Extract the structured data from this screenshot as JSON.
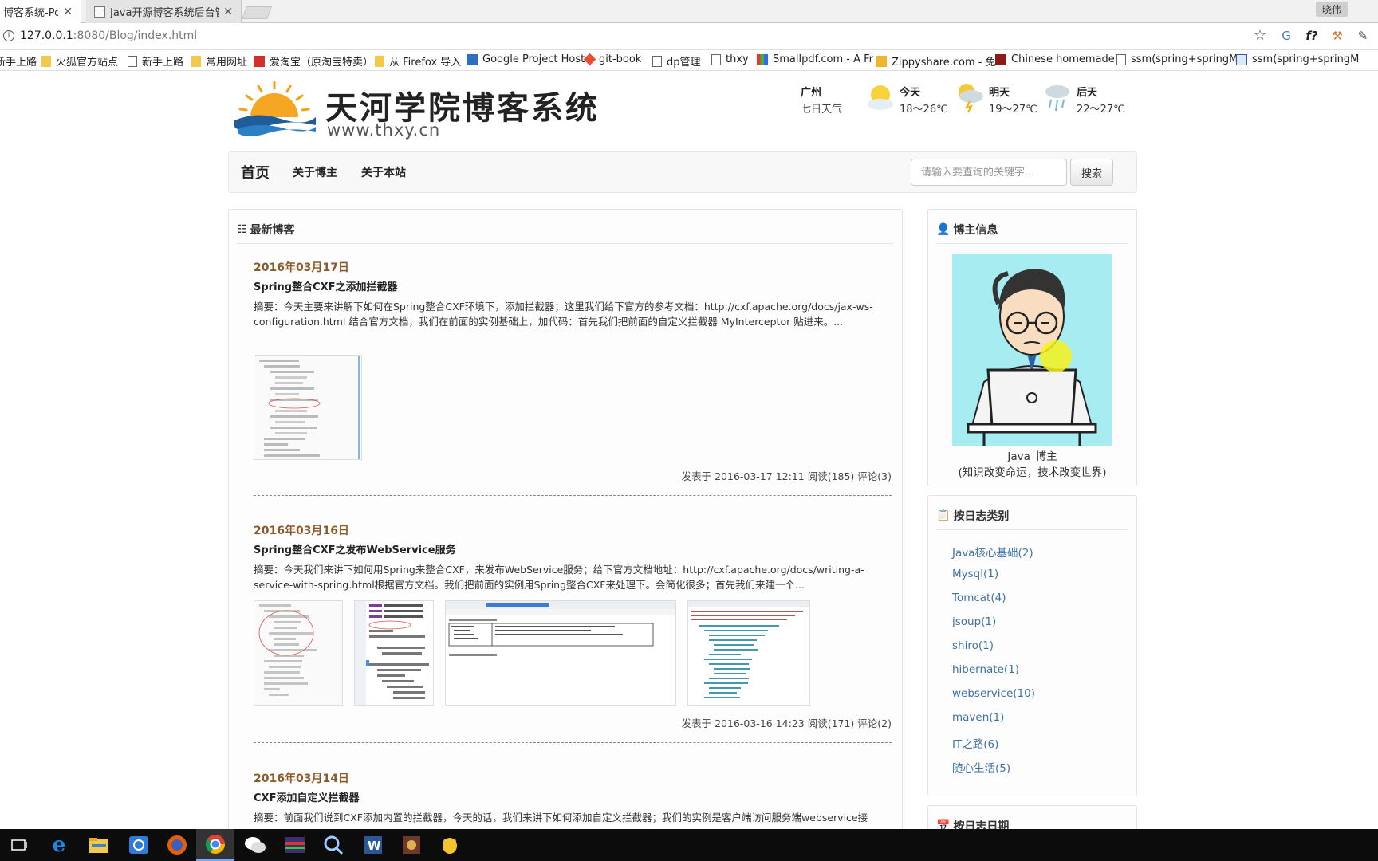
{
  "browser": {
    "tabs": [
      {
        "title": "博客系统-Powe",
        "active": true
      },
      {
        "title": "Java开源博客系统后台管",
        "active": false
      }
    ],
    "profile_name": "晓伟",
    "url_host": "127.0.0.1",
    "url_path": ":8080/Blog/index.html",
    "bookmarks": [
      {
        "label": "新手上路",
        "icon": "folder-icon"
      },
      {
        "label": "火狐官方站点",
        "icon": "folder-icon"
      },
      {
        "label": "新手上路",
        "icon": "page-icon"
      },
      {
        "label": "常用网址",
        "icon": "folder-icon"
      },
      {
        "label": "爱淘宝（原淘宝特卖）",
        "icon": "taobao-icon"
      },
      {
        "label": "从 Firefox 导入",
        "icon": "folder-icon"
      },
      {
        "label": "Google Project Host",
        "icon": "google-project-icon"
      },
      {
        "label": "git-book",
        "icon": "git-icon"
      },
      {
        "label": "dp管理",
        "icon": "page-icon"
      },
      {
        "label": "thxy",
        "icon": "page-icon"
      },
      {
        "label": "Smallpdf.com - A Fr",
        "icon": "smallpdf-icon"
      },
      {
        "label": "Zippyshare.com - 免",
        "icon": "zippyshare-icon"
      },
      {
        "label": "Chinese homemade",
        "icon": "chinese-homemade-icon"
      },
      {
        "label": "ssm(spring+springM",
        "icon": "page-icon"
      },
      {
        "label": "ssm(spring+springM",
        "icon": "ssm-icon"
      }
    ]
  },
  "header": {
    "site_title": "天河学院博客系统",
    "site_url": "www.thxy.cn",
    "weather": {
      "city": "广州",
      "subtitle": "七日天气",
      "days": [
        {
          "name": "今天",
          "temp": "18～26℃",
          "icon": "sunny-cloudy-icon"
        },
        {
          "name": "明天",
          "temp": "19～27℃",
          "icon": "thunderstorm-icon"
        },
        {
          "name": "后天",
          "temp": "22～27℃",
          "icon": "rain-icon"
        }
      ]
    }
  },
  "nav": {
    "items": [
      "首页",
      "关于博主",
      "关于本站"
    ],
    "search_placeholder": "请输入要查询的关键字...",
    "search_button": "搜索"
  },
  "main": {
    "heading": "最新博客",
    "posts": [
      {
        "date": "2016年03月17日",
        "title": "Spring整合CXF之添加拦截器",
        "summary": "摘要：今天主要来讲解下如何在Spring整合CXF环境下，添加拦截器；这里我们给下官方的参考文档：http://cxf.apache.org/docs/jax-ws-configuration.html 结合官方文档，我们在前面的实例基础上，加代码：首先我们把前面的自定义拦截器 MyInterceptor 贴进来。...",
        "meta": "发表于 2016-03-17 12:11 阅读(185) 评论(3)"
      },
      {
        "date": "2016年03月16日",
        "title": "Spring整合CXF之发布WebService服务",
        "summary": "摘要：今天我们来讲下如何用Spring来整合CXF，来发布WebService服务；给下官方文档地址：http://cxf.apache.org/docs/writing-a-service-with-spring.html根据官方文档。我们把前面的实例用Spring整合CXF来处理下。会简化很多；首先我们来建一个...",
        "meta": "发表于 2016-03-16 14:23 阅读(171) 评论(2)"
      },
      {
        "date": "2016年03月14日",
        "title": "CXF添加自定义拦截器",
        "summary": "摘要：前面我们说到CXF添加内置的拦截器，今天的话，我们来讲下如何添加自定义拦截器；我们的实例是客户端访问服务端webservice接"
      }
    ]
  },
  "sidebar": {
    "blogger": {
      "heading": "博主信息",
      "name": "Java_博主",
      "motto": "(知识改变命运，技术改变世界)"
    },
    "categories": {
      "heading": "按日志类别",
      "items": [
        "Java核心基础(2)",
        "Mysql(1)",
        "Tomcat(4)",
        "jsoup(1)",
        "shiro(1)",
        "hibernate(1)",
        "webservice(10)",
        "maven(1)",
        "IT之路(6)",
        "随心生活(5)"
      ]
    },
    "dates_heading": "按日志日期"
  },
  "taskbar": {
    "items": [
      "task-view-icon",
      "edge-icon",
      "file-explorer-icon",
      "network-icon",
      "firefox-icon",
      "chrome-icon",
      "wechat-icon",
      "app-icon",
      "search-tool-icon",
      "word-icon",
      "game-icon",
      "qq-icon"
    ]
  }
}
